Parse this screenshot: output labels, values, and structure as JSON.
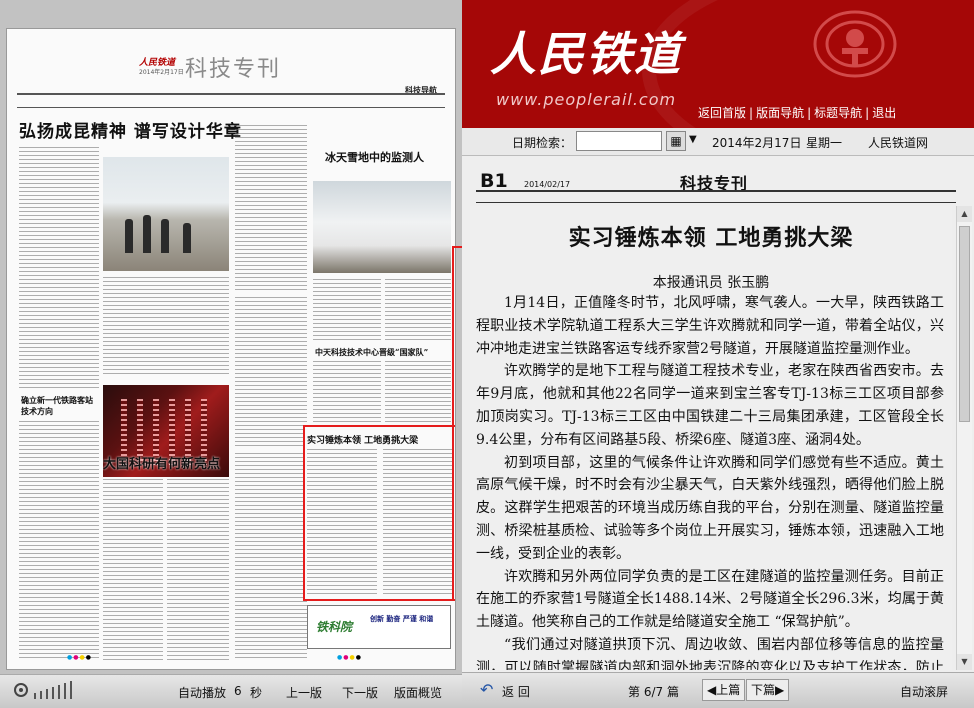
{
  "newspaper": {
    "logo": "人民铁道",
    "date": "2014年2月17日",
    "section": "科技专刊",
    "nav_label": "科技导航",
    "headline_main": "弘扬成昆精神 谱写设计华章",
    "headline_snow": "冰天雪地中的监测人",
    "headline_generation": "确立新一代铁路客站技术方向",
    "headline_chip": "大国科研有何新亮点",
    "headline_center": "中天科技技术中心晋级“国家队”",
    "highlight_article_title": "实习锤炼本领 工地勇挑大梁",
    "ad_logo": "铁科院",
    "ad_slogan": "创新 勤奋 严谨 和谐"
  },
  "header": {
    "brand_title": "人民铁道",
    "brand_url": "www.peoplerail.com",
    "nav": [
      "返回首版",
      "版面导航",
      "标题导航",
      "退出"
    ]
  },
  "date_bar": {
    "label": "日期检索：",
    "input_value": "",
    "date": "2014年2月17日",
    "weekday": "星期一",
    "site": "人民铁道网"
  },
  "reader": {
    "page_no": "B1",
    "page_date": "2014/02/17",
    "section": "科技专刊",
    "article": {
      "title": "实习锤炼本领 工地勇挑大梁",
      "byline": "本报通讯员 张玉鹏",
      "paragraphs": [
        "1月14日，正值隆冬时节，北风呼啸，寒气袭人。一大早，陕西铁路工程职业技术学院轨道工程系大三学生许欢腾就和同学一道，带着全站仪，兴冲冲地走进宝兰铁路客运专线乔家营2号隧道，开展隧道监控量测作业。",
        "许欢腾学的是地下工程与隧道工程技术专业，老家在陕西省西安市。去年9月底，他就和其他22名同学一道来到宝兰客专TJ-13标三工区项目部参加顶岗实习。TJ-13标三工区由中国铁建二十三局集团承建，工区管段全长9.4公里，分布有区间路基5段、桥梁6座、隧道3座、涵洞4处。",
        "初到项目部，这里的气候条件让许欢腾和同学们感觉有些不适应。黄土高原气候干燥，时不时会有沙尘暴天气，白天紫外线强烈，晒得他们脸上脱皮。这群学生把艰苦的环境当成历练自我的平台，分别在测量、隧道监控量测、桥梁桩基质检、试验等多个岗位上开展实习，锤炼本领，迅速融入工地一线，受到企业的表彰。",
        "许欢腾和另外两位同学负责的是工区在建隧道的监控量测任务。目前正在施工的乔家营1号隧道全长1488.14米、2号隧道全长296.3米，均属于黄土隧道。他笑称自己的工作就是给隧道安全施工 “保驾护航”。",
        "“我们通过对隧道拱顶下沉、周边收敛、围岩内部位移等信息的监控量测，可以随时掌握隧道内部和洞外地表沉降的变化以及支护工作状态，防止隧道出现险情。"
      ]
    }
  },
  "left_toolbar": {
    "autoplay_label": "自动播放",
    "autoplay_seconds": "6",
    "seconds_unit": "秒",
    "prev_page": "上一版",
    "next_page": "下一版",
    "overview": "版面概览"
  },
  "right_toolbar": {
    "back": "返 回",
    "page_prefix": "第",
    "page_current": "6",
    "page_sep": "/",
    "page_total": "7",
    "page_suffix": "篇",
    "prev_article": "◀上篇",
    "next_article": "下篇▶",
    "auto_flip": "自动滚屏"
  },
  "colors": {
    "brand_red": "#a50707",
    "highlight_red": "#e51c1c"
  },
  "icons": [
    "zoom-icon",
    "calendar-icon",
    "back-arrow-icon",
    "emblem-icon",
    "scroll-up-icon",
    "scroll-down-icon"
  ]
}
